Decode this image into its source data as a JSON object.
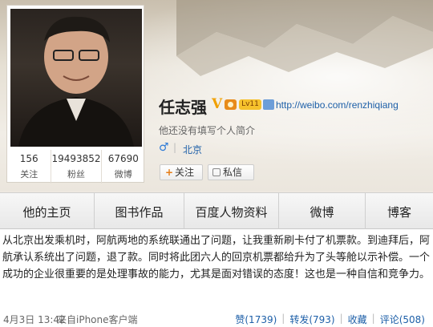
{
  "profile": {
    "name": "任志强",
    "verified_mark": "V",
    "level_badge": "Lv11",
    "url": "http://weibo.com/renzhiqiang",
    "intro": "他还没有填写个人简介",
    "gender_symbol": "♂",
    "city": "北京",
    "stats": [
      {
        "value": "156",
        "label": "关注"
      },
      {
        "value": "19493852",
        "label": "粉丝"
      },
      {
        "value": "67690",
        "label": "微博"
      }
    ],
    "follow_label": "关注",
    "message_label": "私信"
  },
  "tabs": [
    "他的主页",
    "图书作品",
    "百度人物资料",
    "微博",
    "博客"
  ],
  "post": {
    "text": "从北京出发乘机时，阿航两地的系统联通出了问题，让我重新刷卡付了机票款。到迪拜后，阿航承认系统出了问题，退了款。同时将此团六人的回京机票都给升为了头等舱以示补偿。一个成功的企业很重要的是处理事故的能力，尤其是面对错误的态度！这也是一种自信和竞争力。",
    "time": "4月3日 13:42",
    "source": "来自iPhone客户端",
    "actions": [
      {
        "label": "赞(1739)"
      },
      {
        "label": "转发(793)"
      },
      {
        "label": "收藏"
      },
      {
        "label": "评论(508)"
      }
    ]
  },
  "colors": {
    "link": "#1d5fa8",
    "follow_plus": "#e57c16",
    "verified": "#f0a000"
  }
}
